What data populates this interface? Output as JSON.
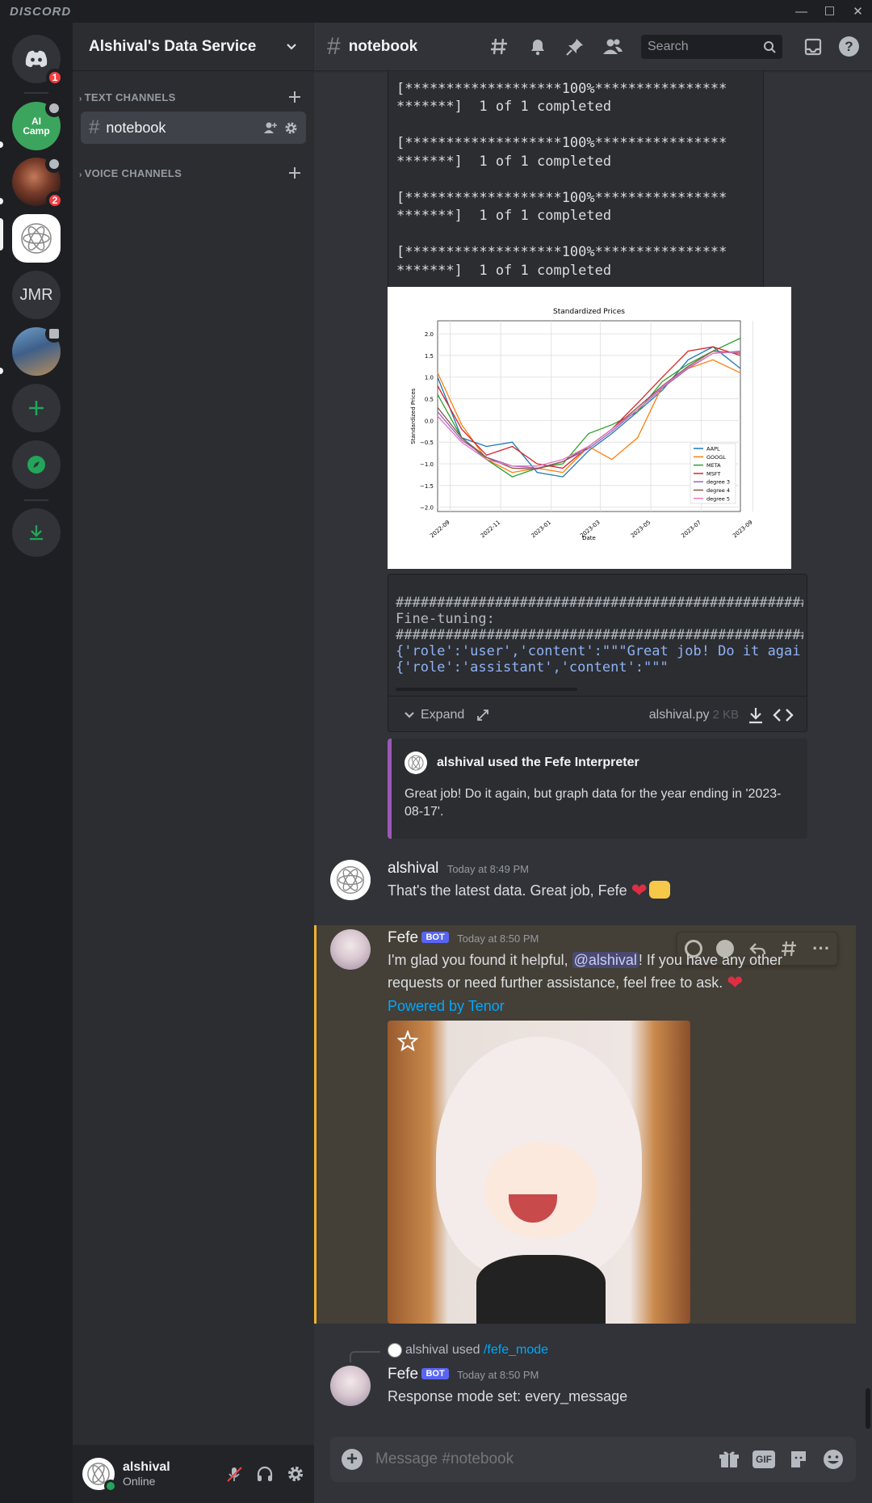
{
  "titlebar": {
    "brand": "DISCORD"
  },
  "guilds": {
    "home_badge": "1",
    "aicamp_label": "AI Camp",
    "server2_badge": "2",
    "jmr_label": "JMR"
  },
  "sidebar": {
    "server_name": "Alshival's Data Service",
    "text_category": "TEXT CHANNELS",
    "voice_category": "VOICE CHANNELS",
    "channel": "notebook"
  },
  "user": {
    "name": "alshival",
    "status": "Online"
  },
  "topbar": {
    "channel": "notebook",
    "search_placeholder": "Search"
  },
  "code_output": {
    "lines": [
      "[*******************100%****************",
      "*******]  1 of 1 completed",
      "",
      "[*******************100%****************",
      "*******]  1 of 1 completed",
      "",
      "[*******************100%****************",
      "*******]  1 of 1 completed",
      "",
      "[*******************100%****************",
      "*******]  1 of 1 completed"
    ]
  },
  "chart_data": {
    "type": "line",
    "title": "Standardized Prices",
    "xlabel": "Date",
    "ylabel": "Standardized Prices",
    "x_ticks": [
      "2022-09",
      "2022-11",
      "2023-01",
      "2023-03",
      "2023-05",
      "2023-07",
      "2023-09"
    ],
    "y_ticks": [
      "2.0",
      "1.5",
      "1.0",
      "0.5",
      "0.0",
      "−0.5",
      "−1.0",
      "−1.5",
      "−2.0"
    ],
    "ylim": [
      -2.1,
      2.3
    ],
    "grid": true,
    "legend_position": "lower right",
    "x": [
      "2022-08-17",
      "2022-09-15",
      "2022-10-15",
      "2022-11-15",
      "2022-12-15",
      "2023-01-15",
      "2023-02-15",
      "2023-03-15",
      "2023-04-15",
      "2023-05-15",
      "2023-06-15",
      "2023-07-15",
      "2023-08-17"
    ],
    "series": [
      {
        "name": "AAPL",
        "color": "#1f77b4",
        "values": [
          1.0,
          -0.4,
          -0.6,
          -0.5,
          -1.2,
          -1.3,
          -0.7,
          -0.3,
          0.2,
          0.7,
          1.4,
          1.7,
          1.2
        ]
      },
      {
        "name": "GOOGL",
        "color": "#ff7f0e",
        "values": [
          1.1,
          -0.1,
          -0.9,
          -1.2,
          -1.1,
          -1.2,
          -0.6,
          -0.9,
          -0.4,
          0.8,
          1.2,
          1.4,
          1.1
        ]
      },
      {
        "name": "META",
        "color": "#2ca02c",
        "values": [
          0.6,
          -0.4,
          -0.9,
          -1.3,
          -1.1,
          -1.0,
          -0.3,
          -0.1,
          0.2,
          0.9,
          1.3,
          1.6,
          1.9
        ]
      },
      {
        "name": "MSFT",
        "color": "#d62728",
        "values": [
          0.8,
          -0.2,
          -0.8,
          -0.6,
          -1.0,
          -1.1,
          -0.6,
          -0.2,
          0.4,
          1.0,
          1.6,
          1.7,
          1.5
        ]
      },
      {
        "name": "degree 3",
        "color": "#9467bd",
        "values": [
          0.2,
          -0.45,
          -0.85,
          -1.05,
          -1.1,
          -0.95,
          -0.65,
          -0.25,
          0.25,
          0.75,
          1.2,
          1.55,
          1.6
        ]
      },
      {
        "name": "degree 4",
        "color": "#8c564b",
        "values": [
          0.3,
          -0.4,
          -0.85,
          -1.1,
          -1.12,
          -0.95,
          -0.6,
          -0.2,
          0.3,
          0.8,
          1.25,
          1.6,
          1.55
        ]
      },
      {
        "name": "degree 5",
        "color": "#e377c2",
        "values": [
          0.1,
          -0.5,
          -0.9,
          -1.05,
          -1.05,
          -0.9,
          -0.6,
          -0.2,
          0.25,
          0.78,
          1.22,
          1.55,
          1.58
        ]
      }
    ]
  },
  "code_file": {
    "lines": [
      "#####################################################",
      "Fine-tuning:",
      "#####################################################",
      "{'role':'user','content':\"\"\"Great job! Do it agai",
      "{'role':'assistant','content':\"\"\""
    ],
    "expand_label": "Expand",
    "filename": "alshival.py",
    "filesize": "2 KB"
  },
  "interaction": {
    "title": "alshival used the Fefe Interpreter",
    "body": "Great job! Do it again, but graph data for the year ending in '2023-08-17'."
  },
  "messages": [
    {
      "author": "alshival",
      "time": "Today at 8:49 PM",
      "text": "That's the latest data. Great job, Fefe"
    },
    {
      "author": "Fefe",
      "badge": "BOT",
      "time": "Today at 8:50 PM",
      "text_before": "I'm glad you found it helpful, ",
      "mention": "@alshival",
      "text_after": "! If you have any other requests or need further assistance, feel free to ask.",
      "link": "Powered by Tenor"
    },
    {
      "reply_user": "alshival",
      "reply_used": "used",
      "reply_cmd": "/fefe_mode",
      "author": "Fefe",
      "badge": "BOT",
      "time": "Today at 8:50 PM",
      "text": "Response mode set: every_message"
    }
  ],
  "composer": {
    "placeholder": "Message #notebook",
    "gif": "GIF"
  }
}
